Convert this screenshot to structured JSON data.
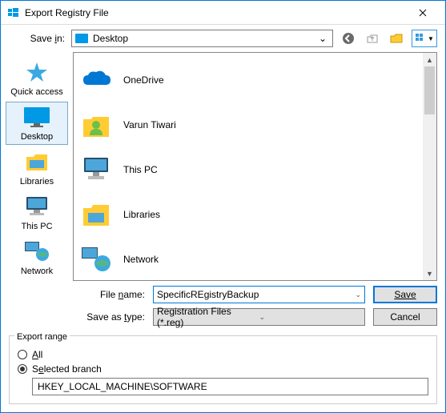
{
  "window": {
    "title": "Export Registry File"
  },
  "toolbar": {
    "save_in_label": "Save in:",
    "save_in_value": "Desktop",
    "icons": {
      "back": "back-icon",
      "up": "up-icon",
      "newfolder": "new-folder-icon",
      "views": "views-icon"
    }
  },
  "places": [
    {
      "id": "quick-access",
      "label": "Quick access"
    },
    {
      "id": "desktop",
      "label": "Desktop",
      "selected": true
    },
    {
      "id": "libraries",
      "label": "Libraries"
    },
    {
      "id": "this-pc",
      "label": "This PC"
    },
    {
      "id": "network",
      "label": "Network"
    }
  ],
  "files": [
    {
      "id": "onedrive",
      "label": "OneDrive"
    },
    {
      "id": "user",
      "label": "Varun Tiwari"
    },
    {
      "id": "thispc",
      "label": "This PC"
    },
    {
      "id": "libraries",
      "label": "Libraries"
    },
    {
      "id": "network",
      "label": "Network"
    }
  ],
  "fields": {
    "filename_label": "File name:",
    "filename_value": "SpecificREgistryBackup",
    "savetype_label": "Save as type:",
    "savetype_value": "Registration Files (*.reg)"
  },
  "buttons": {
    "save": "Save",
    "cancel": "Cancel"
  },
  "export_range": {
    "legend": "Export range",
    "all_label": "All",
    "selected_label": "Selected branch",
    "branch_value": "HKEY_LOCAL_MACHINE\\SOFTWARE",
    "selected": "branch"
  }
}
